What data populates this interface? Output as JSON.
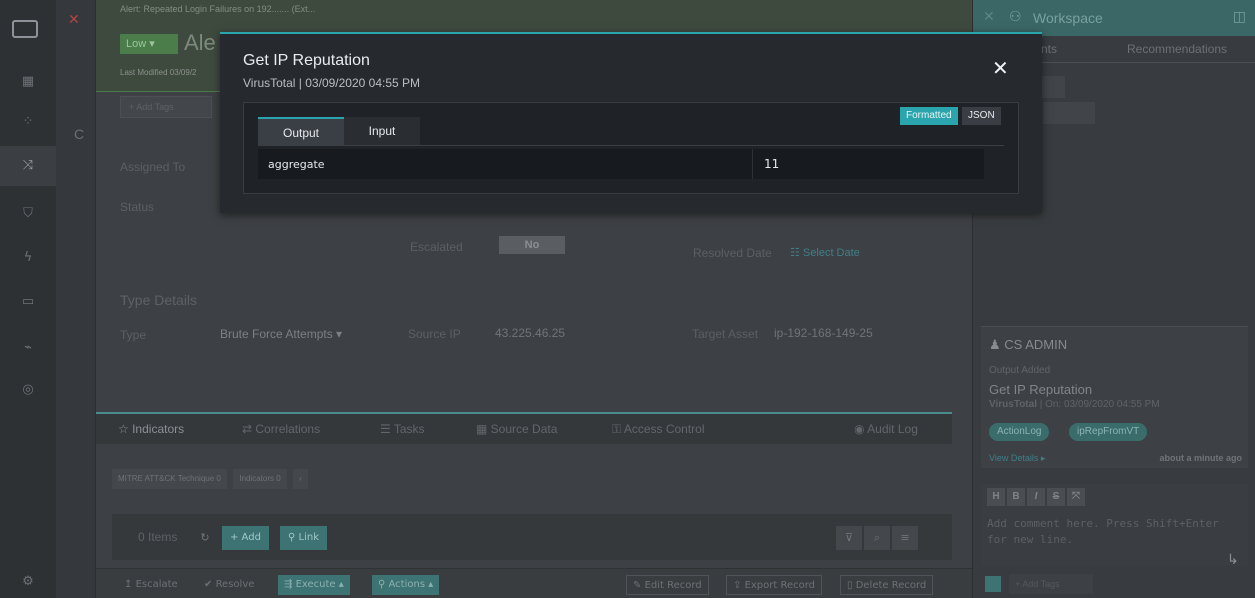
{
  "rail": {
    "icons": [
      "app-grid-icon",
      "dashboard-icon",
      "modules-icon",
      "shuffle-icon",
      "shield-icon",
      "bolt-icon",
      "briefcase-icon",
      "chart-icon",
      "globe-icon",
      "settings-icon"
    ],
    "letter": "C"
  },
  "alert": {
    "breadcrumb": "Alert: Repeated Login Failures on 192....... (Ext...",
    "severity": "Low ▾",
    "title": "Ale",
    "last_modified": "Last Modified 03/09/2",
    "add_tags_placeholder": "+ Add Tags"
  },
  "fields": {
    "assigned_to_label": "Assigned To",
    "status_label": "Status",
    "escalated_label": "Escalated",
    "escalated_value": "No",
    "resolved_date_label": "Resolved Date",
    "resolved_date_value": "Select Date",
    "type_details_title": "Type Details",
    "type_label": "Type",
    "type_value": "Brute Force Attempts ▾",
    "source_ip_label": "Source IP",
    "source_ip_value": "43.225.46.25",
    "target_asset_label": "Target Asset",
    "target_asset_value": "ip-192-168-149-25"
  },
  "tabs": {
    "indicators": "Indicators",
    "correlations": "Correlations",
    "tasks": "Tasks",
    "source_data": "Source Data",
    "access_control": "Access Control",
    "audit_log": "Audit Log"
  },
  "subtabs": {
    "mitre": "MITRE ATT&CK Technique 0",
    "indicators": "Indicators 0"
  },
  "items": {
    "count": "0 Items",
    "add": "+ Add",
    "link": "Link"
  },
  "footer": {
    "escalate": "Escalate",
    "resolve": "Resolve",
    "execute": "Execute ▴",
    "actions": "Actions ▴",
    "edit_record": "Edit Record",
    "export_record": "Export Record",
    "delete_record": "Delete Record"
  },
  "workspace": {
    "title": "Workspace",
    "tab_comments": "nts",
    "tab_recommendations": "Recommendations",
    "activity": {
      "user": "CS ADMIN",
      "event": "Output Added",
      "title": "Get IP Reputation",
      "meta_source": "VirusTotal",
      "meta_time": "On: 03/09/2020 04:55 PM",
      "tags": [
        "ActionLog",
        "ipRepFromVT"
      ],
      "view_details": "View Details ▸",
      "ago": "about a minute ago"
    },
    "editor": {
      "buttons": [
        "H",
        "B",
        "I",
        "S",
        "⤧"
      ],
      "placeholder": "Add comment here. Press Shift+Enter for new line."
    },
    "add_tags": "+ Add Tags"
  },
  "modal": {
    "title": "Get IP Reputation",
    "subtitle": "VirusTotal | 03/09/2020 04:55 PM",
    "close": "✕",
    "tab_output": "Output",
    "tab_input": "Input",
    "view_formatted": "Formatted",
    "view_json": "JSON",
    "rows": [
      {
        "key": "aggregate",
        "value": "11"
      }
    ]
  },
  "colors": {
    "accent": "#2aa4ad",
    "modal_bg": "#262a2f",
    "severity_low": "#4a7d4a"
  }
}
